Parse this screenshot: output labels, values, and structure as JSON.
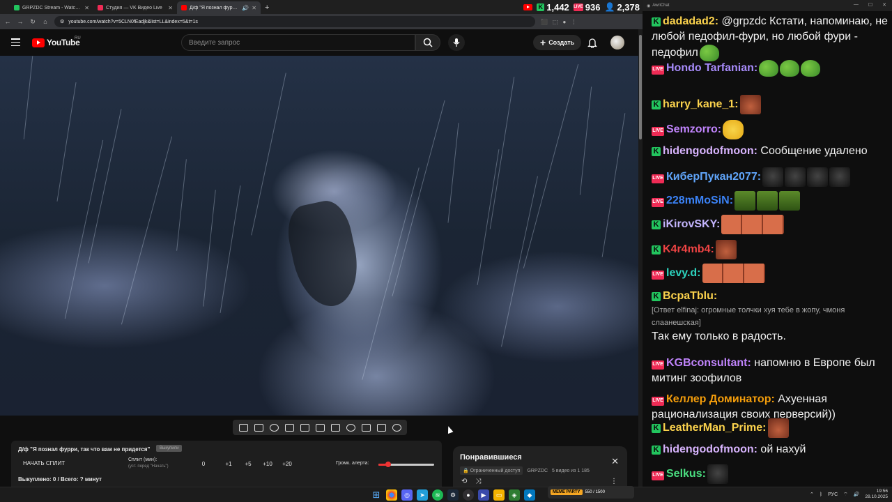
{
  "browser": {
    "tabs": [
      {
        "label": "GRPZDC Stream - Watch Live o",
        "color": "#22c55e"
      },
      {
        "label": "Студия — VK Видео Live",
        "color": "#ef2b55"
      },
      {
        "label": "Д/ф \"Я познал фурри, так",
        "color": "#ff0000"
      }
    ],
    "url": "youtube.com/watch?v=5CLN0fEadjk&list=LL&index=5&t=1s"
  },
  "stream_stats": {
    "kick": "1,442",
    "vk": "936",
    "twitch": "2,378",
    "vk_label": "LIVE"
  },
  "youtube": {
    "logo_text": "YouTube",
    "region": "RU",
    "search_placeholder": "Введите запрос",
    "create_label": "Создать"
  },
  "split_panel": {
    "title": "Д/ф \"Я познал фурри, так что вам не придется\"",
    "tag": "Выкупили",
    "start_label": "НАЧАТЬ СПЛИТ",
    "split_label": "Сплит (мин):",
    "split_hint": "(уст. перед \"Начать\")",
    "buttons": [
      "0",
      "+1",
      "+5",
      "+10",
      "+20"
    ],
    "alert_label": "Громк. алерта:",
    "alert_volume": 0.18,
    "total": "Выкуплено: 0 / Всего: ? минут"
  },
  "liked_panel": {
    "title": "Понравившиеся",
    "access": "Ограниченный доступ",
    "channel": "GRPZDC",
    "count": "5 видео из 1 185"
  },
  "chat": {
    "window_title": "AwriChat",
    "messages": [
      {
        "platform": "kick",
        "user": "dadadad2:",
        "color": "#fcd34d",
        "text": "@grpzdc Кстати, напоминаю, не любой педофил-фури, но любой фури - педофил",
        "emotes": [
          "pepe"
        ]
      },
      {
        "platform": "vk",
        "user": "Hondo Tarfanian:",
        "color": "#a78bfa",
        "text": "",
        "emotes": [
          "pepe",
          "pepe",
          "pepe"
        ]
      },
      {
        "platform": "kick",
        "user": "harry_kane_1:",
        "color": "#fcd34d",
        "text": "",
        "emotes": [
          "face"
        ]
      },
      {
        "platform": "vk",
        "user": "Semzorro:",
        "color": "#c084fc",
        "text": "",
        "emotes": [
          "lemon"
        ]
      },
      {
        "platform": "kick",
        "user": "hidengodofmoon:",
        "color": "#d8b4fe",
        "text": "Сообщение удалено",
        "emotes": []
      },
      {
        "platform": "vk",
        "user": "КиберПукан2077:",
        "color": "#60a5fa",
        "text": "",
        "emotes": [
          "cat",
          "cat",
          "cat",
          "cat"
        ]
      },
      {
        "platform": "vk",
        "user": "228mMoSiN:",
        "color": "#3b82f6",
        "text": "",
        "emotes": [
          "croc",
          "croc",
          "croc"
        ]
      },
      {
        "platform": "kick",
        "user": "iKirovSKY:",
        "color": "#c4b5fd",
        "text": "",
        "emotes": [
          "face-wide"
        ]
      },
      {
        "platform": "kick",
        "user": "K4r4mb4:",
        "color": "#ef4444",
        "text": "",
        "emotes": [
          "face"
        ]
      },
      {
        "platform": "vk",
        "user": "levy.d:",
        "color": "#2dd4bf",
        "text": "",
        "emotes": [
          "face-wide"
        ]
      },
      {
        "platform": "kick",
        "user": "ВсраТblu:",
        "color": "#fcd34d",
        "reply": "[Ответ elfinaj: огромные толчки хуя тебе в жопу, чмоня слаанешская]",
        "text": "Так ему только в радость.",
        "emotes": []
      },
      {
        "platform": "vk",
        "user": "KGBconsultant:",
        "color": "#c084fc",
        "text": "напомню в Европе был митинг зоофилов",
        "emotes": []
      },
      {
        "platform": "vk",
        "user": "Келлер Доминатор:",
        "color": "#f59e0b",
        "text": "Ахуенная рационализация своих перверсий))",
        "emotes": []
      },
      {
        "platform": "kick",
        "user": "LeatherMan_Prime:",
        "color": "#fcd34d",
        "text": "",
        "emotes": [
          "face"
        ]
      },
      {
        "platform": "kick",
        "user": "hidengodofmoon:",
        "color": "#d8b4fe",
        "text": "ой нахуй",
        "emotes": []
      },
      {
        "platform": "vk",
        "user": "Selkus:",
        "color": "#4ade80",
        "text": "",
        "emotes": [
          "cat"
        ]
      }
    ]
  },
  "taskbar": {
    "meme_label": "MEME PARTY",
    "meme_counter": "550 / 1500",
    "lang": "РУС",
    "time": "19:56",
    "date": "28.10.2025"
  }
}
